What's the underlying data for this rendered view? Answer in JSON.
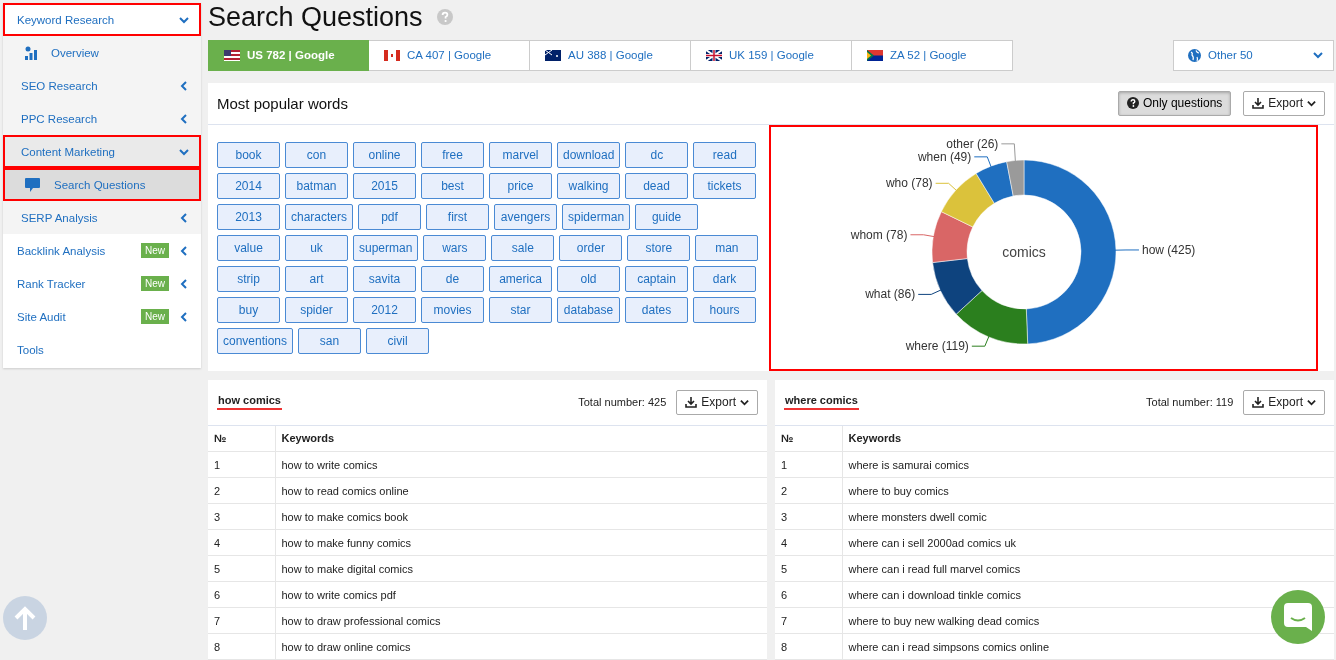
{
  "sidebar": {
    "items": [
      {
        "label": "Keyword Research",
        "expanded": true,
        "selected": false,
        "highlighted": true,
        "children": [
          {
            "label": "Overview",
            "kind": "icon",
            "selected": false,
            "highlighted": false
          },
          {
            "label": "SEO Research",
            "kind": "menu",
            "expanded": false,
            "selected": false,
            "highlighted": false
          },
          {
            "label": "PPC Research",
            "kind": "menu",
            "expanded": false,
            "selected": false,
            "highlighted": false
          },
          {
            "label": "Content Marketing",
            "kind": "menu",
            "expanded": true,
            "selected": false,
            "highlighted": true,
            "children": [
              {
                "label": "Search Questions",
                "kind": "chat",
                "selected": true,
                "highlighted": true
              }
            ]
          },
          {
            "label": "SERP Analysis",
            "kind": "menu",
            "expanded": false,
            "selected": false,
            "highlighted": false
          }
        ]
      },
      {
        "label": "Backlink Analysis",
        "badge": "New",
        "expanded": false,
        "selected": false,
        "highlighted": false
      },
      {
        "label": "Rank Tracker",
        "badge": "New",
        "expanded": false,
        "selected": false,
        "highlighted": false
      },
      {
        "label": "Site Audit",
        "badge": "New",
        "expanded": false,
        "selected": false,
        "highlighted": false
      },
      {
        "label": "Tools",
        "selected": false,
        "highlighted": false
      }
    ]
  },
  "page": {
    "title": "Search Questions"
  },
  "tabs": [
    {
      "label": "US 782 | Google",
      "selected": true
    },
    {
      "label": "CA 407 | Google",
      "selected": false
    },
    {
      "label": "AU 388 | Google",
      "selected": false
    },
    {
      "label": "UK 159 | Google",
      "selected": false
    },
    {
      "label": "ZA 52 | Google",
      "selected": false
    }
  ],
  "other_dropdown": {
    "label": "Other 50"
  },
  "words_panel": {
    "title": "Most popular words",
    "only_questions_button": {
      "label": "Only questions",
      "on": true
    },
    "export_button": "Export",
    "words": [
      "book",
      "con",
      "online",
      "free",
      "marvel",
      "download",
      "dc",
      "read",
      "2014",
      "batman",
      "2015",
      "best",
      "price",
      "walking",
      "dead",
      "tickets",
      "2013",
      "characters",
      "pdf",
      "first",
      "avengers",
      "spiderman",
      "guide",
      "value",
      "uk",
      "superman",
      "wars",
      "sale",
      "order",
      "store",
      "man",
      "strip",
      "art",
      "savita",
      "de",
      "america",
      "old",
      "captain",
      "dark",
      "buy",
      "spider",
      "2012",
      "movies",
      "star",
      "database",
      "dates",
      "hours",
      "conventions",
      "san",
      "civil"
    ],
    "chart_highlighted": true,
    "chart_data": {
      "type": "donut",
      "title": "comics",
      "categories": [
        "how (425)",
        "where (119)",
        "what (86)",
        "whom (78)",
        "who (78)",
        "when (49)",
        "other (26)"
      ],
      "values": [
        425,
        119,
        86,
        78,
        78,
        49,
        26
      ],
      "colors": [
        "#1f6fc0",
        "#2b7f1e",
        "#0e437e",
        "#d96666",
        "#dbc23b",
        "#1f6fc0",
        "#9a9a9a"
      ]
    }
  },
  "tables": [
    {
      "title": "how comics",
      "total": "Total number: 425",
      "export_button": "Export",
      "columns": [
        "№",
        "Keywords"
      ],
      "rows": [
        [
          "1",
          "how to write comics"
        ],
        [
          "2",
          "how to read comics online"
        ],
        [
          "3",
          "how to make comics book"
        ],
        [
          "4",
          "how to make funny comics"
        ],
        [
          "5",
          "how to make digital comics"
        ],
        [
          "6",
          "how to write comics pdf"
        ],
        [
          "7",
          "how to draw professional comics"
        ],
        [
          "8",
          "how to draw online comics"
        ]
      ]
    },
    {
      "title": "where comics",
      "total": "Total number: 119",
      "export_button": "Export",
      "columns": [
        "№",
        "Keywords"
      ],
      "rows": [
        [
          "1",
          "where is samurai comics"
        ],
        [
          "2",
          "where to buy comics"
        ],
        [
          "3",
          "where monsters dwell comic"
        ],
        [
          "4",
          "where can i sell 2000ad comics uk"
        ],
        [
          "5",
          "where can i read full marvel comics"
        ],
        [
          "6",
          "where can i download tinkle comics"
        ],
        [
          "7",
          "where to buy new walking dead comics"
        ],
        [
          "8",
          "where can i read simpsons comics online"
        ]
      ]
    }
  ]
}
